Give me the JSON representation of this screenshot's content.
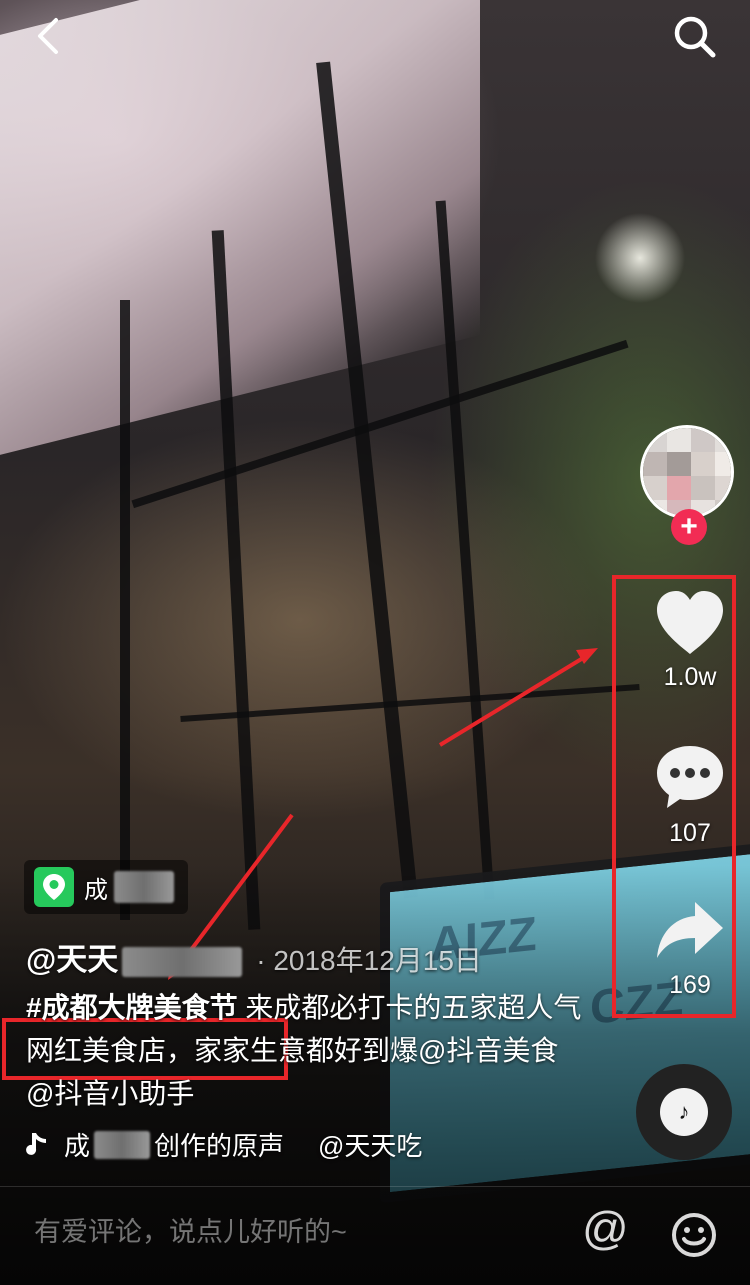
{
  "video": {
    "location": {
      "prefix": "成"
    },
    "author": {
      "handle_visible": "@天天",
      "date": "2018年12月15日"
    },
    "description": {
      "hashtag": "#成都大牌美食节",
      "text": " 来成都必打卡的五家超人气网红美食店，家家生意都好到爆@抖音美食 @抖音小助手"
    },
    "music": {
      "prefix": "成",
      "suffix": "创作的原声",
      "author": "@天天吃"
    }
  },
  "actions": {
    "like_count": "1.0w",
    "comment_count": "107",
    "share_count": "169",
    "follow_symbol": "+"
  },
  "comment_bar": {
    "placeholder": "有爱评论，说点儿好听的~",
    "at_symbol": "@"
  },
  "colors": {
    "annotation_red": "#e8262a",
    "follow_pink": "#f22c54",
    "location_green": "#26c95c"
  },
  "icons": [
    "back-arrow-icon",
    "search-icon",
    "heart-icon",
    "comment-icon",
    "share-icon",
    "location-pin-icon",
    "music-note-icon",
    "emoji-icon",
    "music-disc-icon"
  ]
}
